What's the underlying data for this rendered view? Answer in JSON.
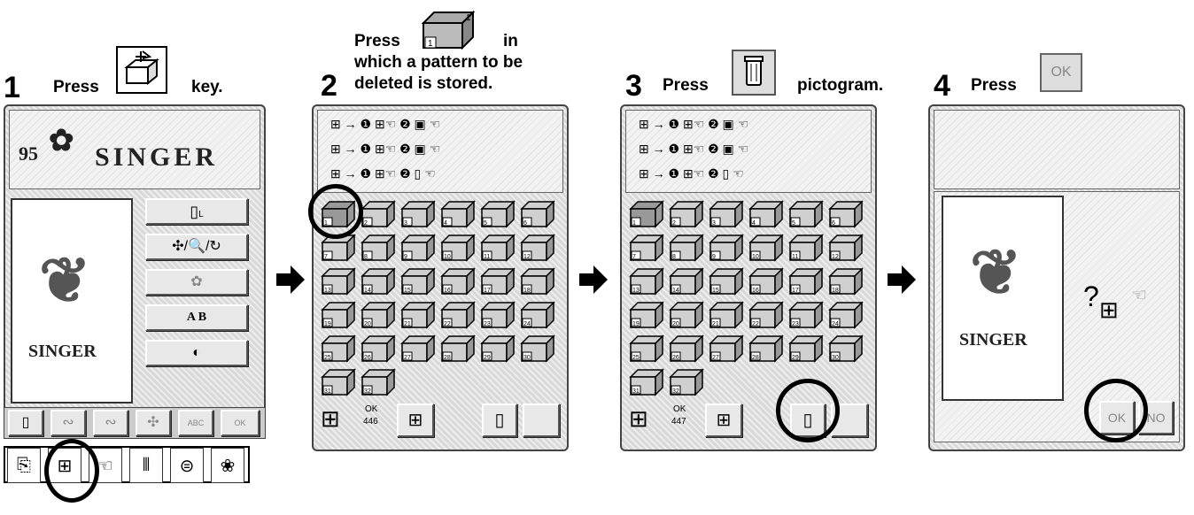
{
  "steps": [
    {
      "num": "1",
      "text_before": "Press",
      "text_after": "key."
    },
    {
      "num": "2",
      "line1_before": "Press",
      "line1_after": "in",
      "line2": "which a pattern to be",
      "line3": "deleted is stored."
    },
    {
      "num": "3",
      "text_before": "Press",
      "text_after": "pictogram."
    },
    {
      "num": "4",
      "text_before": "Press",
      "ok_key_label": "OK"
    }
  ],
  "screen1": {
    "brand": "SINGER",
    "logo_code": "95",
    "preview_label": "SINGER",
    "side_buttons": [
      "",
      "",
      "",
      "A B",
      ""
    ]
  },
  "screen2": {
    "ok_label": "OK",
    "count": "446",
    "box_numbers": [
      "1",
      "2",
      "3",
      "4",
      "5",
      "6",
      "7",
      "8",
      "9",
      "10",
      "11",
      "12",
      "13",
      "14",
      "15",
      "16",
      "17",
      "18",
      "19",
      "20",
      "21",
      "22",
      "23",
      "24",
      "25",
      "26",
      "27",
      "28",
      "29",
      "30",
      "31",
      "32"
    ]
  },
  "screen3": {
    "ok_label": "OK",
    "count": "447"
  },
  "screen4": {
    "preview_label": "SINGER",
    "question": "?",
    "ok_button": "OK",
    "no_button": "NO"
  },
  "icons": [
    "storage-box-icon",
    "trash-icon",
    "arrow-right-icon",
    "hand-icon",
    "thread-spool-icon",
    "bobbin-icon",
    "flower-icon"
  ]
}
